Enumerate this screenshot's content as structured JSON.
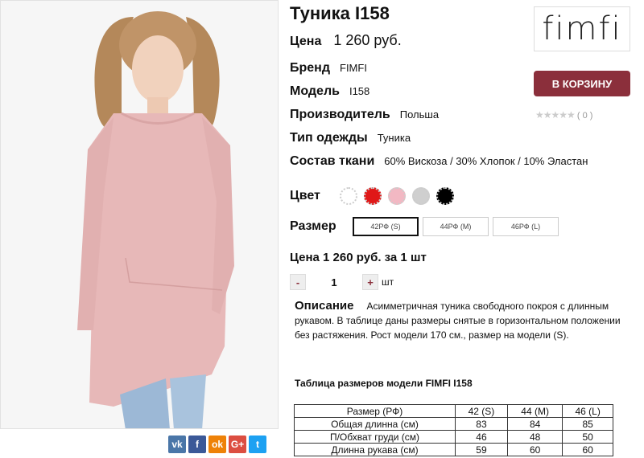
{
  "product": {
    "title": "Туника I158",
    "price_label": "Цена",
    "price": "1 260 руб."
  },
  "attributes": [
    {
      "label": "Бренд",
      "value": "FIMFI"
    },
    {
      "label": "Модель",
      "value": "I158"
    },
    {
      "label": "Производитель",
      "value": "Польша"
    },
    {
      "label": "Тип одежды",
      "value": "Туника"
    },
    {
      "label": "Состав ткани",
      "value": "60% Вискоза / 30% Хлопок / 10% Эластан"
    }
  ],
  "brand_logo": "fimfi",
  "cart_button": "В КОРЗИНУ",
  "rating": {
    "stars": "★★★★★",
    "count": "( 0 )"
  },
  "colors": {
    "label": "Цвет",
    "swatches": [
      "#ffffff",
      "#e01818",
      "#f2b8c3",
      "#cfcfcf",
      "#000000"
    ]
  },
  "sizes": {
    "label": "Размер",
    "options": [
      "42РФ (S)",
      "44РФ (M)",
      "46РФ (L)"
    ],
    "selected": "42РФ (S)"
  },
  "price_per_unit": "Цена 1 260 руб. за 1 шт",
  "quantity": {
    "minus": "-",
    "value": "1",
    "plus": "+",
    "unit": "шт"
  },
  "description": {
    "label": "Описание",
    "text": "Асимметричная туника свободного покроя с длинным рукавом. В таблице даны размеры снятые в горизонтальном положении без растяжения. Рост модели 170 см., размер на модели (S)."
  },
  "size_table": {
    "title": "Таблица размеров модели FIMFI I158",
    "headers": [
      "Размер (РФ)",
      "42 (S)",
      "44 (M)",
      "46 (L)"
    ],
    "rows": [
      [
        "Общая длинна (см)",
        "83",
        "84",
        "85"
      ],
      [
        "П/Обхват груди (см)",
        "46",
        "48",
        "50"
      ],
      [
        "Длинна рукава (см)",
        "59",
        "60",
        "60"
      ]
    ]
  },
  "share": [
    {
      "icon": "vk-icon",
      "glyph": "vk",
      "color": "#4a76a8"
    },
    {
      "icon": "facebook-icon",
      "glyph": "f",
      "color": "#3b5998"
    },
    {
      "icon": "odnoklassniki-icon",
      "glyph": "ok",
      "color": "#ee8208"
    },
    {
      "icon": "google-plus-icon",
      "glyph": "G+",
      "color": "#dc4e41"
    },
    {
      "icon": "twitter-icon",
      "glyph": "t",
      "color": "#1da1f2"
    }
  ]
}
